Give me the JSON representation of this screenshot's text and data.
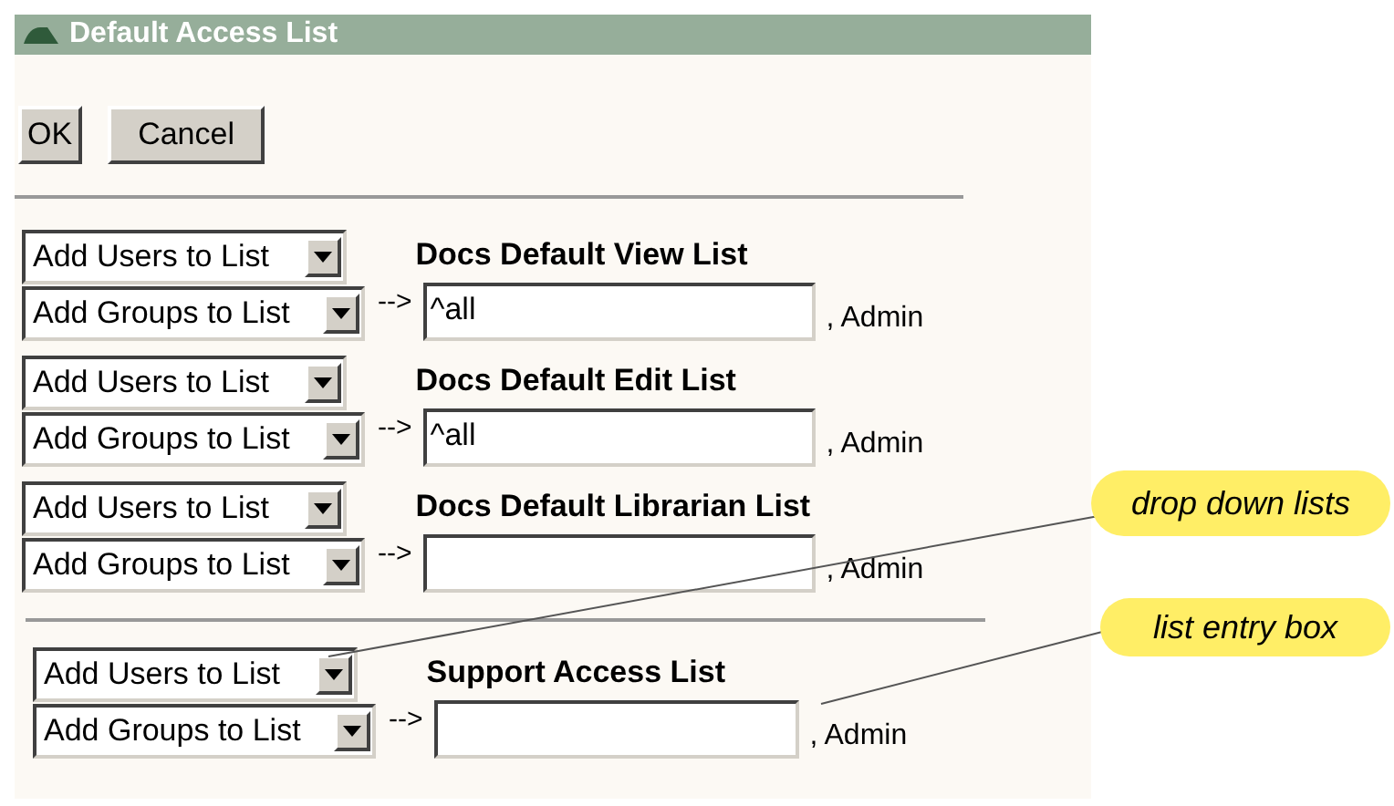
{
  "window": {
    "title": "Default Access List"
  },
  "buttons": [
    "OK",
    "Cancel"
  ],
  "lists": [
    {
      "add_users": "Add Users to List",
      "add_groups": "Add Groups to List",
      "arrow": "-->",
      "title": "Docs Default View List",
      "value": "^all",
      "suffix": ", Admin"
    },
    {
      "add_users": "Add Users to List",
      "add_groups": "Add Groups to List",
      "arrow": "-->",
      "title": "Docs Default Edit List",
      "value": "^all",
      "suffix": ", Admin"
    },
    {
      "add_users": "Add Users to List",
      "add_groups": "Add Groups to List",
      "arrow": "-->",
      "title": "Docs Default Librarian List",
      "suffix": ", Admin"
    }
  ],
  "support_list": {
    "add_users": "Add Users to List",
    "add_groups": "Add Groups to List",
    "arrow": "-->",
    "title": "Support Access List",
    "suffix": ", Admin"
  },
  "callouts": [
    {
      "text": "drop down lists"
    },
    {
      "text": "list entry box"
    }
  ]
}
